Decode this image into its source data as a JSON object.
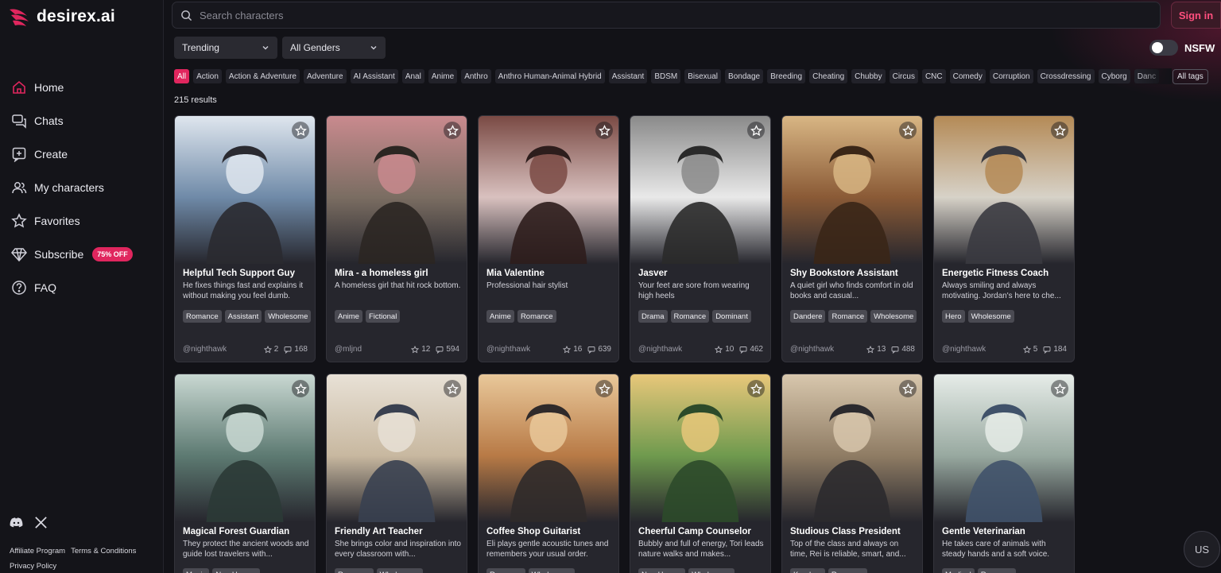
{
  "brand": {
    "name": "desirex.ai"
  },
  "sidebar": {
    "items": [
      {
        "label": "Home",
        "icon": "home-icon"
      },
      {
        "label": "Chats",
        "icon": "chats-icon"
      },
      {
        "label": "Create",
        "icon": "create-icon"
      },
      {
        "label": "My characters",
        "icon": "users-icon"
      },
      {
        "label": "Favorites",
        "icon": "star-icon"
      },
      {
        "label": "Subscribe",
        "icon": "diamond-icon",
        "badge": "75% OFF"
      },
      {
        "label": "FAQ",
        "icon": "help-icon"
      }
    ],
    "footer": {
      "affiliate": "Affiliate Program",
      "terms": "Terms & Conditions",
      "privacy": "Privacy Policy"
    }
  },
  "header": {
    "search_placeholder": "Search characters",
    "signin_label": "Sign in"
  },
  "filters": {
    "sort": "Trending",
    "gender": "All Genders",
    "nsfw_label": "NSFW",
    "nsfw_enabled": false,
    "all_tags_label": "All tags"
  },
  "tags": [
    "All",
    "Action",
    "Action & Adventure",
    "Adventure",
    "AI Assistant",
    "Anal",
    "Anime",
    "Anthro",
    "Anthro Human-Animal Hybrid",
    "Assistant",
    "BDSM",
    "Bisexual",
    "Bondage",
    "Breeding",
    "Cheating",
    "Chubby",
    "Circus",
    "CNC",
    "Comedy",
    "Corruption",
    "Crossdressing",
    "Cyborg",
    "Danc"
  ],
  "results_label": "215 results",
  "cards": [
    {
      "title": "Helpful Tech Support Guy",
      "description": "He fixes things fast and explains it without making you feel dumb.",
      "tags": [
        "Romance",
        "Assistant",
        "Wholesome"
      ],
      "author": "@nighthawk",
      "stars": "2",
      "chats": "168"
    },
    {
      "title": "Mira - a homeless girl",
      "description": "A homeless girl that hit rock bottom.",
      "tags": [
        "Anime",
        "Fictional"
      ],
      "author": "@mljnd",
      "stars": "12",
      "chats": "594"
    },
    {
      "title": "Mia Valentine",
      "description": "Professional hair stylist",
      "tags": [
        "Anime",
        "Romance"
      ],
      "author": "@nighthawk",
      "stars": "16",
      "chats": "639"
    },
    {
      "title": "Jasver",
      "description": "Your feet are sore from wearing high heels",
      "tags": [
        "Drama",
        "Romance",
        "Dominant"
      ],
      "author": "@nighthawk",
      "stars": "10",
      "chats": "462"
    },
    {
      "title": "Shy Bookstore Assistant",
      "description": "A quiet girl who finds comfort in old books and casual...",
      "tags": [
        "Dandere",
        "Romance",
        "Wholesome"
      ],
      "author": "@nighthawk",
      "stars": "13",
      "chats": "488"
    },
    {
      "title": "Energetic Fitness Coach",
      "description": "Always smiling and always motivating. Jordan's here to che...",
      "tags": [
        "Hero",
        "Wholesome"
      ],
      "author": "@nighthawk",
      "stars": "5",
      "chats": "184"
    },
    {
      "title": "Magical Forest Guardian",
      "description": "They protect the ancient woods and guide lost travelers with...",
      "tags": [
        "Magic",
        "Non-Human"
      ],
      "author": "",
      "stars": "",
      "chats": ""
    },
    {
      "title": "Friendly Art Teacher",
      "description": "She brings color and inspiration into every classroom with...",
      "tags": [
        "Romance",
        "Wholesome"
      ],
      "author": "",
      "stars": "",
      "chats": ""
    },
    {
      "title": "Coffee Shop Guitarist",
      "description": "Eli plays gentle acoustic tunes and remembers your usual order.",
      "tags": [
        "Romance",
        "Wholesome"
      ],
      "author": "",
      "stars": "",
      "chats": ""
    },
    {
      "title": "Cheerful Camp Counselor",
      "description": "Bubbly and full of energy, Tori leads nature walks and makes...",
      "tags": [
        "Non-Human",
        "Wholesome"
      ],
      "author": "",
      "stars": "",
      "chats": ""
    },
    {
      "title": "Studious Class President",
      "description": "Top of the class and always on time, Rei is reliable, smart, and...",
      "tags": [
        "Kuudere",
        "Romance"
      ],
      "author": "",
      "stars": "",
      "chats": ""
    },
    {
      "title": "Gentle Veterinarian",
      "description": "He takes care of animals with steady hands and a soft voice.",
      "tags": [
        "Medical",
        "Romance"
      ],
      "author": "",
      "stars": "",
      "chats": ""
    }
  ],
  "language_button": "US",
  "colors": {
    "accent": "#e0265e",
    "background": "#121217",
    "card": "#26262d"
  }
}
